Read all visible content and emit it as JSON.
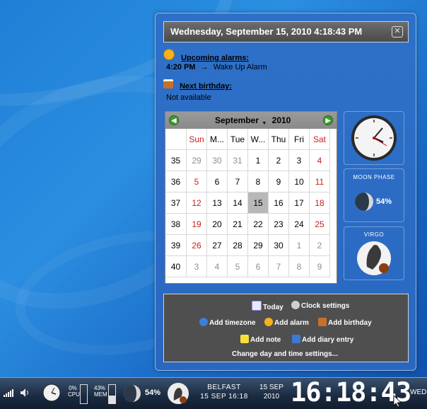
{
  "header": {
    "datetime": "Wednesday, September 15, 2010 4:18:43 PM",
    "close_glyph": "✕"
  },
  "alarms": {
    "heading": "Upcoming alarms:",
    "time": "4:20 PM",
    "arrow": "→",
    "name": "Wake Up Alarm"
  },
  "birthday": {
    "heading": "Next birthday:",
    "value": "Not available"
  },
  "calendar": {
    "month_label": "September",
    "year_label": "2010",
    "prev_glyph": "◀",
    "next_glyph": "▶",
    "day_headers": [
      "Sun",
      "M...",
      "Tue",
      "W...",
      "Thu",
      "Fri",
      "Sat"
    ],
    "weeks": [
      {
        "num": "35",
        "days": [
          "29",
          "30",
          "31",
          "1",
          "2",
          "3",
          "4"
        ]
      },
      {
        "num": "36",
        "days": [
          "5",
          "6",
          "7",
          "8",
          "9",
          "10",
          "11"
        ]
      },
      {
        "num": "37",
        "days": [
          "12",
          "13",
          "14",
          "15",
          "16",
          "17",
          "18"
        ]
      },
      {
        "num": "38",
        "days": [
          "19",
          "20",
          "21",
          "22",
          "23",
          "24",
          "25"
        ]
      },
      {
        "num": "39",
        "days": [
          "26",
          "27",
          "28",
          "29",
          "30",
          "1",
          "2"
        ]
      },
      {
        "num": "40",
        "days": [
          "3",
          "4",
          "5",
          "6",
          "7",
          "8",
          "9"
        ]
      }
    ],
    "today": "15"
  },
  "widgets": {
    "moon_title": "MOON PHASE",
    "moon_value": "54%",
    "sign_title": "VIRGO"
  },
  "actions": {
    "today": "Today",
    "clock_settings": "Clock settings",
    "add_timezone": "Add timezone",
    "add_alarm": "Add alarm",
    "add_birthday": "Add birthday",
    "add_note": "Add note",
    "add_diary": "Add diary entry",
    "change_settings": "Change day and time settings..."
  },
  "taskbar": {
    "cpu_value": "0%",
    "cpu_label": "CPU",
    "mem_value": "43%",
    "mem_label": "MEM",
    "moon_value": "54%",
    "city": "BELFAST",
    "city_date": "15 SEP 16:18",
    "date_top": "15 SEP",
    "date_bottom": "2010",
    "big_time": "16:18:43",
    "weekday": "WED"
  },
  "colors": {
    "weekend": "#d11b1b",
    "inactive": "#8f8f8f",
    "today_bg": "#b8b8b8",
    "panel": "#2e70c8"
  }
}
